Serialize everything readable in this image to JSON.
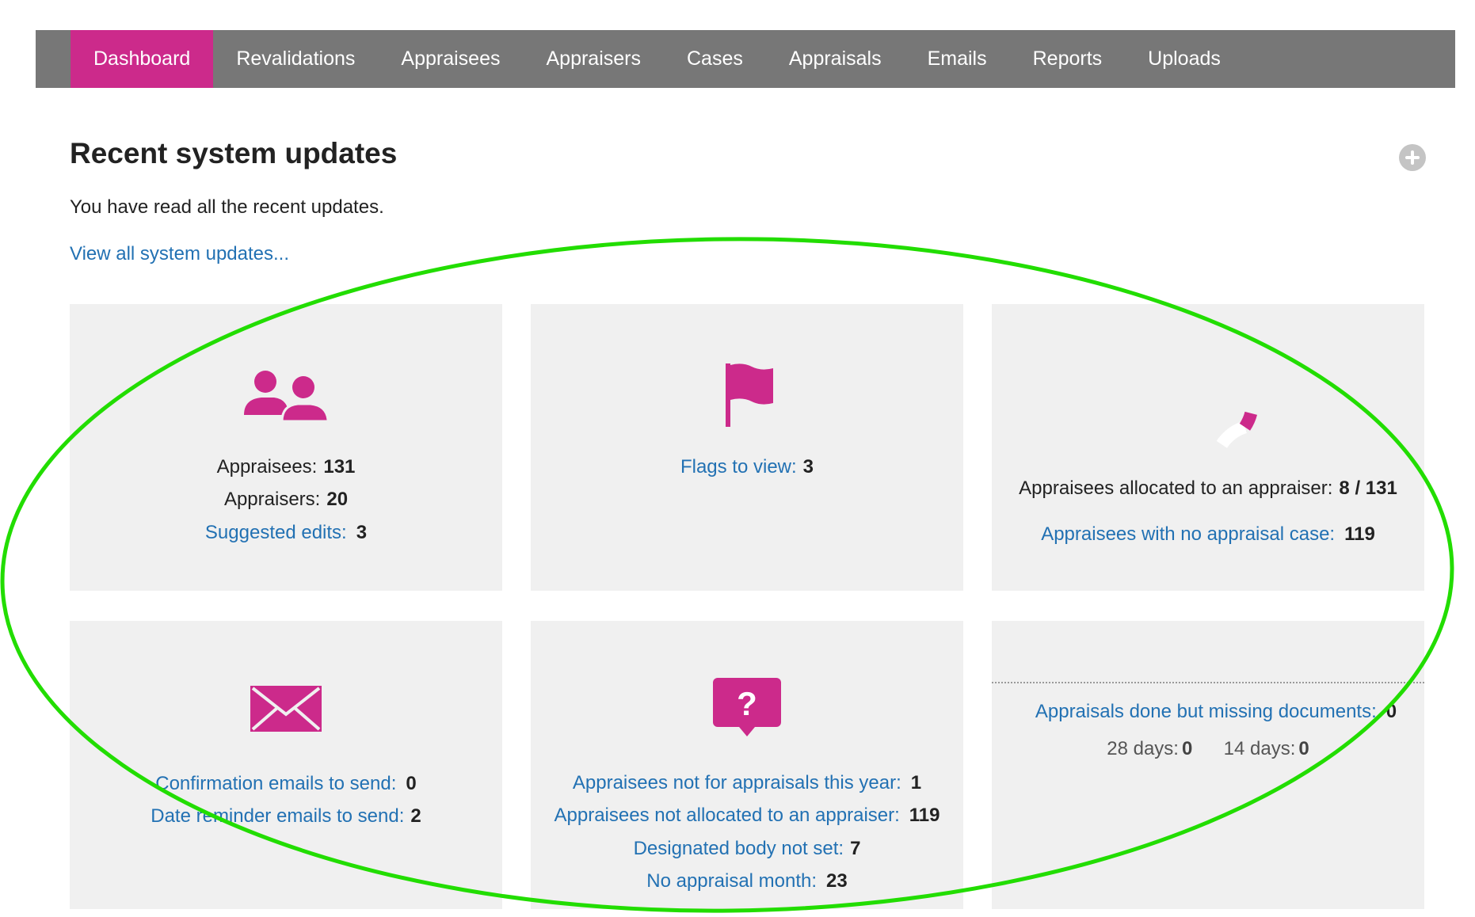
{
  "nav": {
    "items": [
      {
        "label": "Dashboard",
        "active": true
      },
      {
        "label": "Revalidations"
      },
      {
        "label": "Appraisees"
      },
      {
        "label": "Appraisers"
      },
      {
        "label": "Cases"
      },
      {
        "label": "Appraisals"
      },
      {
        "label": "Emails"
      },
      {
        "label": "Reports"
      },
      {
        "label": "Uploads"
      }
    ]
  },
  "updates": {
    "title": "Recent system updates",
    "message": "You have read all the recent updates.",
    "view_all_link": "View all system updates..."
  },
  "cards": {
    "people": {
      "icon": "users-icon",
      "appraisees_label": "Appraisees:",
      "appraisees_value": "131",
      "appraisers_label": "Appraisers:",
      "appraisers_value": "20",
      "suggested_label": "Suggested edits:",
      "suggested_value": "3"
    },
    "flags": {
      "icon": "flag-icon",
      "label": "Flags to view:",
      "value": "3"
    },
    "allocation": {
      "icon": "progress-ring-icon",
      "progress_fraction": 0.061,
      "allocated_label": "Appraisees allocated to an appraiser:",
      "allocated_value": "8 / 131",
      "no_case_label": "Appraisees with no appraisal case:",
      "no_case_value": "119"
    },
    "emails": {
      "icon": "envelope-icon",
      "confirmation_label": "Confirmation emails to send:",
      "confirmation_value": "0",
      "reminder_label": "Date reminder emails to send:",
      "reminder_value": "2"
    },
    "issues": {
      "icon": "question-bubble-icon",
      "not_for_label": "Appraisees not for appraisals this year:",
      "not_for_value": "1",
      "not_allocated_label": "Appraisees not allocated to an appraiser:",
      "not_allocated_value": "119",
      "body_label": "Designated body not set:",
      "body_value": "7",
      "month_label": "No appraisal month:",
      "month_value": "23"
    },
    "missing_docs": {
      "label": "Appraisals done but missing documents:",
      "value": "0",
      "d28_label": "28 days:",
      "d28_value": "0",
      "d14_label": "14 days:",
      "d14_value": "0"
    }
  },
  "colors": {
    "accent": "#cc2a8b",
    "nav_bg": "#777777",
    "link": "#2271b3",
    "card_bg": "#f0f0f0",
    "annotation": "#22dd00"
  }
}
